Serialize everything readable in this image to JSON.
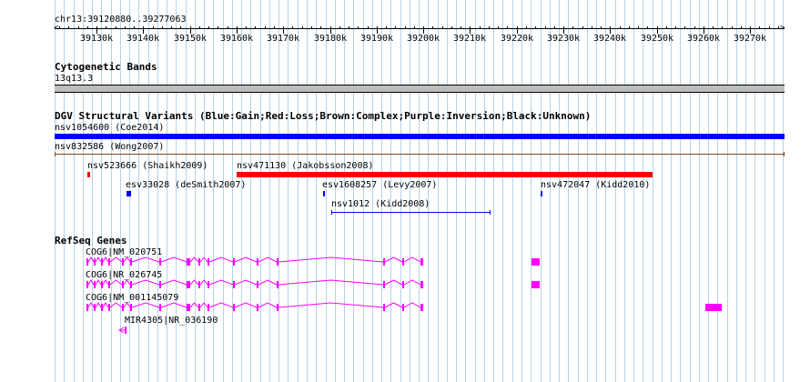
{
  "ruler": {
    "range_label": "chr13:39120880..39277063",
    "ticks": [
      "39130k",
      "39140k",
      "39150k",
      "39160k",
      "39170k",
      "39180k",
      "39190k",
      "39200k",
      "39210k",
      "39220k",
      "39230k",
      "39240k",
      "39250k",
      "39260k",
      "39270k"
    ]
  },
  "cytoband": {
    "title": "Cytogenetic Bands",
    "band": "13q13.3"
  },
  "dgv": {
    "title": "DGV Structural Variants (Blue:Gain;Red:Loss;Brown:Complex;Purple:Inversion;Black:Unknown)",
    "colors": {
      "gain": "#0000ff",
      "loss": "#ff0000",
      "complex": "#8b4513",
      "unknown": "#000000"
    },
    "variants": [
      {
        "label": "nsv1054600 (Coe2014)"
      },
      {
        "label": "nsv832586 (Wong2007)"
      },
      {
        "label": "nsv523666 (Shaikh2009)"
      },
      {
        "label": "nsv471130 (Jakobsson2008)"
      },
      {
        "label": "esv33028 (deSmith2007)"
      },
      {
        "label": "esv1608257 (Levy2007)"
      },
      {
        "label": "nsv472047 (Kidd2010)"
      },
      {
        "label": "nsv1012 (Kidd2008)"
      }
    ]
  },
  "refseq": {
    "title": "RefSeq Genes",
    "color": "#ff00ff",
    "genes": [
      {
        "label": "COG6|NM_020751"
      },
      {
        "label": "COG6|NR_026745"
      },
      {
        "label": "COG6|NM_001145079"
      },
      {
        "label": "MIR4305|NR_036190"
      }
    ]
  }
}
